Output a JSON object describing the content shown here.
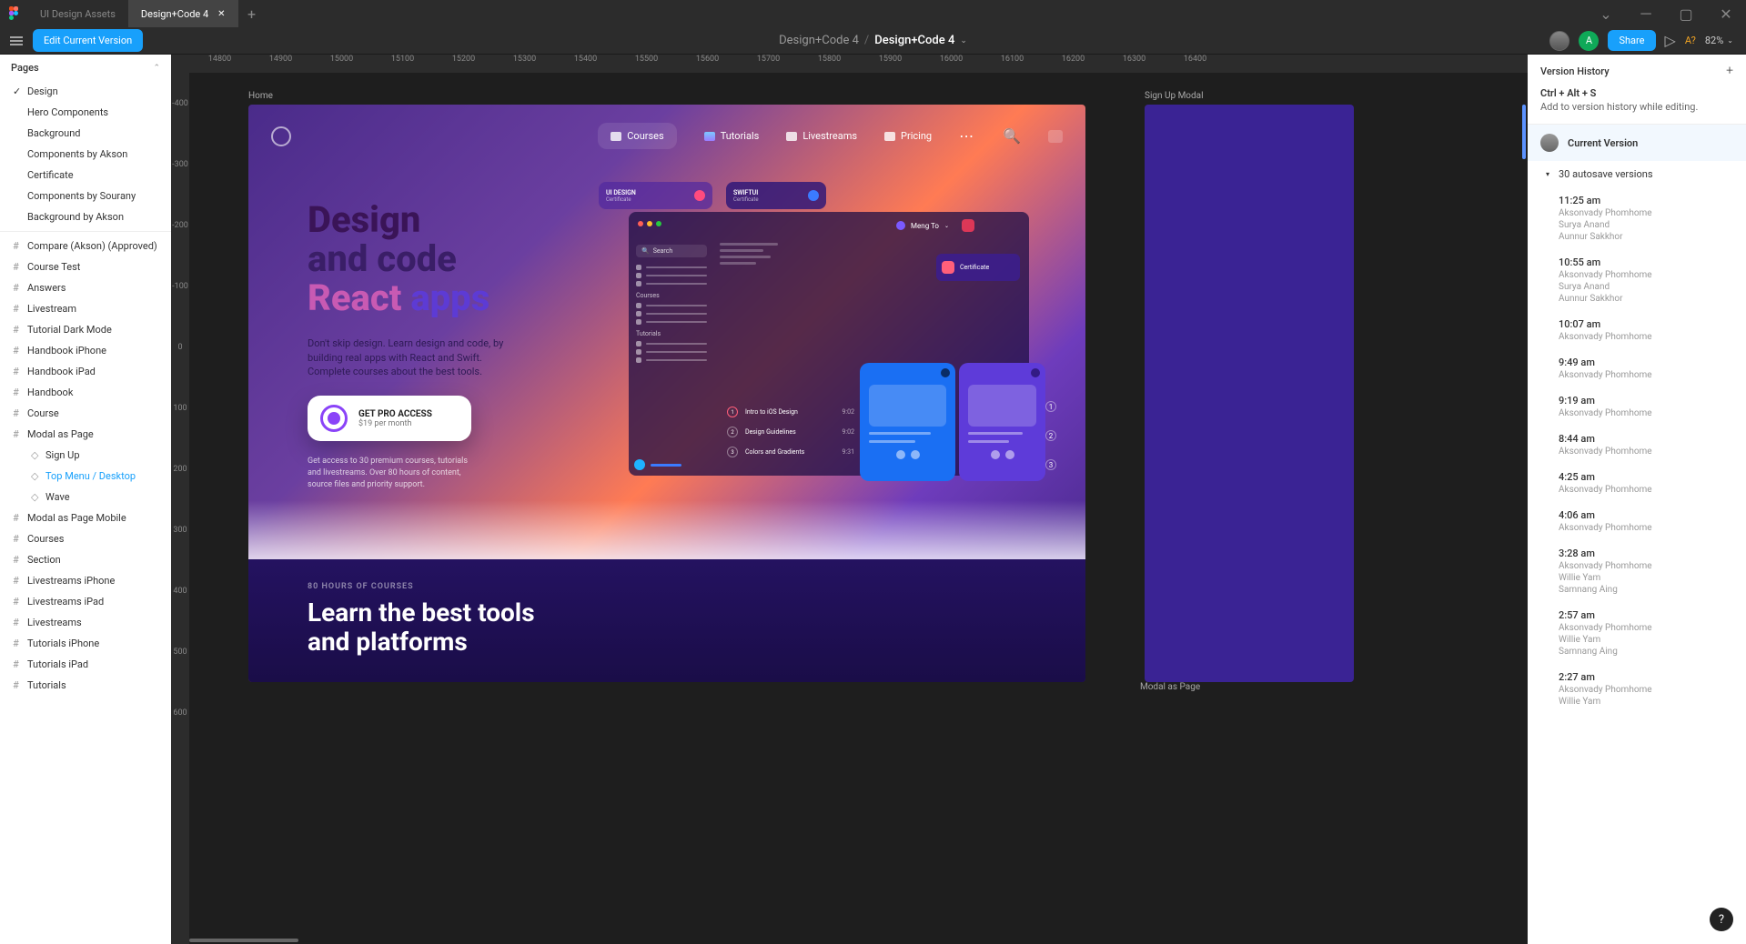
{
  "tabs": [
    {
      "label": "UI Design Assets",
      "active": false
    },
    {
      "label": "Design+Code 4",
      "active": true
    }
  ],
  "toolbar": {
    "edit_btn": "Edit Current Version",
    "crumb_a": "Design+Code 4",
    "crumb_b": "Design+Code 4",
    "share": "Share",
    "a_badge": "A?",
    "zoom": "82%",
    "avatar2_initial": "A"
  },
  "left": {
    "pages_header": "Pages",
    "pages": [
      {
        "label": "Design",
        "selected": true
      },
      {
        "label": "Hero Components"
      },
      {
        "label": "Background"
      },
      {
        "label": "Components by Akson"
      },
      {
        "label": "Certificate"
      },
      {
        "label": "Components by Sourany"
      },
      {
        "label": "Background by Akson"
      }
    ],
    "layers": [
      {
        "label": "Compare (Akson) (Approved)",
        "icon": "#"
      },
      {
        "label": "Course Test",
        "icon": "#"
      },
      {
        "label": "Answers",
        "icon": "#"
      },
      {
        "label": "Livestream",
        "icon": "#"
      },
      {
        "label": "Tutorial Dark Mode",
        "icon": "#"
      },
      {
        "label": "Handbook iPhone",
        "icon": "#"
      },
      {
        "label": "Handbook iPad",
        "icon": "#"
      },
      {
        "label": "Handbook",
        "icon": "#"
      },
      {
        "label": "Course",
        "icon": "#"
      },
      {
        "label": "Modal as Page",
        "icon": "#"
      },
      {
        "label": "Sign Up",
        "icon": "◇",
        "indent": 1
      },
      {
        "label": "Top Menu / Desktop",
        "icon": "◇",
        "indent": 1,
        "hl": true
      },
      {
        "label": "Wave",
        "icon": "◇",
        "indent": 1
      },
      {
        "label": "Modal as Page Mobile",
        "icon": "#"
      },
      {
        "label": "Courses",
        "icon": "#"
      },
      {
        "label": "Section",
        "icon": "#"
      },
      {
        "label": "Livestreams iPhone",
        "icon": "#"
      },
      {
        "label": "Livestreams iPad",
        "icon": "#"
      },
      {
        "label": "Livestreams",
        "icon": "#"
      },
      {
        "label": "Tutorials iPhone",
        "icon": "#"
      },
      {
        "label": "Tutorials iPad",
        "icon": "#"
      },
      {
        "label": "Tutorials",
        "icon": "#"
      }
    ]
  },
  "ruler_h": [
    "14800",
    "14900",
    "15000",
    "15100",
    "15200",
    "15300",
    "15400",
    "15500",
    "15600",
    "15700",
    "15800",
    "15900",
    "16000",
    "16100",
    "16200",
    "16300",
    "16400"
  ],
  "ruler_v": [
    "-400",
    "-300",
    "-200",
    "-100",
    "0",
    "100",
    "200",
    "300",
    "400",
    "500",
    "600"
  ],
  "canvas": {
    "home_label": "Home",
    "signup_label": "Sign Up Modal",
    "modal_label": "Modal as Page",
    "nav": [
      "Courses",
      "Tutorials",
      "Livestreams",
      "Pricing"
    ],
    "hero": {
      "l1": "Design",
      "l2": "and code",
      "l3a": "React",
      "l3b": "apps",
      "sub": "Don't skip design. Learn design and code, by building real apps with React and Swift. Complete courses about the best tools.",
      "pro_title": "GET PRO ACCESS",
      "pro_sub": "$19 per month",
      "access": "Get access to 30 premium courses, tutorials and livestreams. Over 80 hours of content, source files and priority support."
    },
    "mini_ui": {
      "t1": "UI DESIGN",
      "t2": "Certificate"
    },
    "mini_swift": {
      "t1": "SWIFTUI",
      "t2": "Certificate"
    },
    "dash": {
      "user": "Meng To",
      "search": "Search",
      "sec_courses": "Courses",
      "sec_tutorials": "Tutorials",
      "cert": "Certificate",
      "lessons": [
        {
          "num": "1",
          "name": "Intro to iOS Design",
          "dur": "9:02"
        },
        {
          "num": "2",
          "name": "Design Guidelines",
          "dur": "9:02"
        },
        {
          "num": "3",
          "name": "Colors and Gradients",
          "dur": "9:31"
        }
      ],
      "side_nums": [
        "1",
        "2",
        "3"
      ]
    },
    "section2": {
      "eyebrow": "80 HOURS OF COURSES",
      "h2a": "Learn the best tools",
      "h2b": "and platforms"
    }
  },
  "right": {
    "header": "Version History",
    "kb": "Ctrl + Alt + S",
    "note": "Add to version history while editing.",
    "current": "Current Version",
    "autosave": "30 autosave versions",
    "versions": [
      {
        "time": "11:25 am",
        "authors": [
          "Aksonvady Phomhome",
          "Surya Anand",
          "Aunnur Sakkhor"
        ]
      },
      {
        "time": "10:55 am",
        "authors": [
          "Aksonvady Phomhome",
          "Surya Anand",
          "Aunnur Sakkhor"
        ]
      },
      {
        "time": "10:07 am",
        "authors": [
          "Aksonvady Phomhome"
        ]
      },
      {
        "time": "9:49 am",
        "authors": [
          "Aksonvady Phomhome"
        ]
      },
      {
        "time": "9:19 am",
        "authors": [
          "Aksonvady Phomhome"
        ]
      },
      {
        "time": "8:44 am",
        "authors": [
          "Aksonvady Phomhome"
        ]
      },
      {
        "time": "4:25 am",
        "authors": [
          "Aksonvady Phomhome"
        ]
      },
      {
        "time": "4:06 am",
        "authors": [
          "Aksonvady Phomhome"
        ]
      },
      {
        "time": "3:28 am",
        "authors": [
          "Aksonvady Phomhome",
          "Willie Yam",
          "Samnang Aing"
        ]
      },
      {
        "time": "2:57 am",
        "authors": [
          "Aksonvady Phomhome",
          "Willie Yam",
          "Samnang Aing"
        ]
      },
      {
        "time": "2:27 am",
        "authors": [
          "Aksonvady Phomhome",
          "Willie Yam"
        ]
      }
    ]
  }
}
